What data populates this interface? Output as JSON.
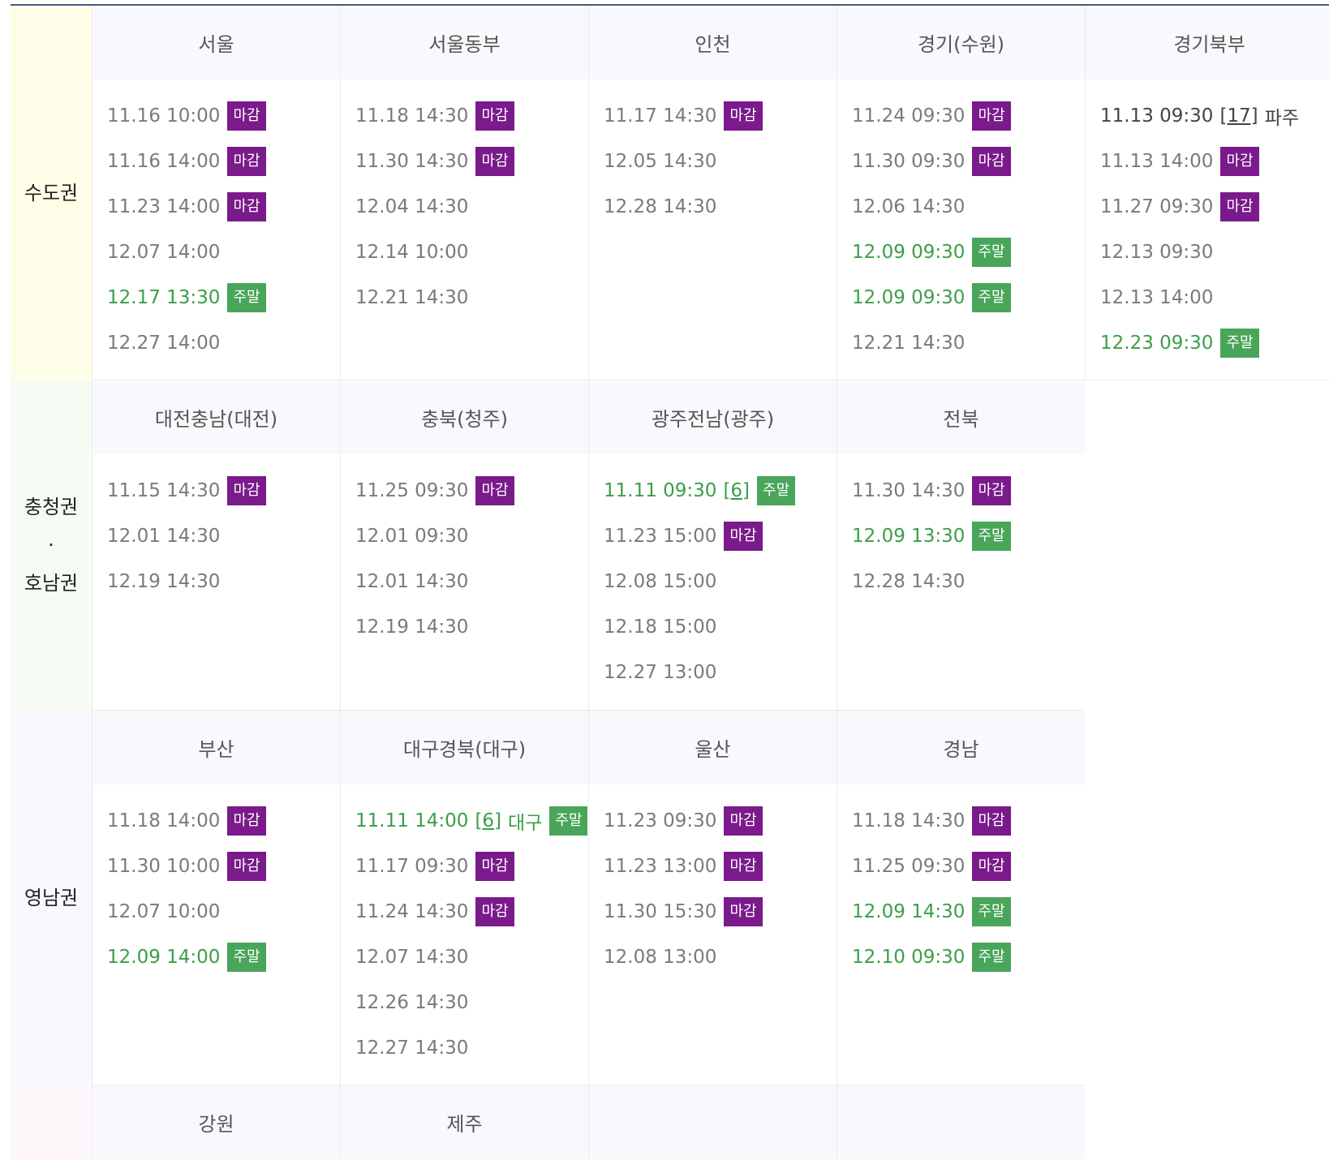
{
  "colors": {
    "closed_badge": "#7a1a8b",
    "weekend_badge": "#48a55a",
    "weekend_text": "#3b9e47",
    "header_bg": "#f8f9fc",
    "region_capital_bg": "#fefee8",
    "region_chungho_bg": "#f6fcf3",
    "region_yeongnam_bg": "#f8f8fd",
    "region_other_bg": "#fdf7fc"
  },
  "regions": [
    {
      "label": "수도권",
      "offices": [
        {
          "name": "서울",
          "sessions": [
            {
              "datetime": "11.16 10:00",
              "badge": "마감"
            },
            {
              "datetime": "11.16 14:00",
              "badge": "마감"
            },
            {
              "datetime": "11.23 14:00",
              "badge": "마감"
            },
            {
              "datetime": "12.07 14:00"
            },
            {
              "datetime": "12.17 13:30",
              "badge": "주말",
              "weekend": true
            },
            {
              "datetime": "12.27 14:00"
            }
          ]
        },
        {
          "name": "서울동부",
          "sessions": [
            {
              "datetime": "11.18 14:30",
              "badge": "마감"
            },
            {
              "datetime": "11.30 14:30",
              "badge": "마감"
            },
            {
              "datetime": "12.04 14:30"
            },
            {
              "datetime": "12.14 10:00"
            },
            {
              "datetime": "12.21 14:30"
            }
          ]
        },
        {
          "name": "인천",
          "sessions": [
            {
              "datetime": "11.17 14:30",
              "badge": "마감"
            },
            {
              "datetime": "12.05 14:30"
            },
            {
              "datetime": "12.28 14:30"
            }
          ]
        },
        {
          "name": "경기(수원)",
          "sessions": [
            {
              "datetime": "11.24 09:30",
              "badge": "마감"
            },
            {
              "datetime": "11.30 09:30",
              "badge": "마감"
            },
            {
              "datetime": "12.06 14:30"
            },
            {
              "datetime": "12.09 09:30",
              "badge": "주말",
              "weekend": true
            },
            {
              "datetime": "12.09 09:30",
              "badge": "주말",
              "weekend": true
            },
            {
              "datetime": "12.21 14:30"
            }
          ]
        },
        {
          "name": "경기북부",
          "sessions": [
            {
              "datetime": "11.13 09:30",
              "number": "[17]",
              "location": "파주",
              "dark": true
            },
            {
              "datetime": "11.13 14:00",
              "badge": "마감"
            },
            {
              "datetime": "11.27 09:30",
              "badge": "마감"
            },
            {
              "datetime": "12.13 09:30"
            },
            {
              "datetime": "12.13 14:00"
            },
            {
              "datetime": "12.23 09:30",
              "badge": "주말",
              "weekend": true
            }
          ]
        }
      ]
    },
    {
      "label": "충청권\n·\n호남권",
      "offices": [
        {
          "name": "대전충남(대전)",
          "sessions": [
            {
              "datetime": "11.15 14:30",
              "badge": "마감"
            },
            {
              "datetime": "12.01 14:30"
            },
            {
              "datetime": "12.19 14:30"
            }
          ]
        },
        {
          "name": "충북(청주)",
          "sessions": [
            {
              "datetime": "11.25 09:30",
              "badge": "마감"
            },
            {
              "datetime": "12.01 09:30"
            },
            {
              "datetime": "12.01 14:30"
            },
            {
              "datetime": "12.19 14:30"
            }
          ]
        },
        {
          "name": "광주전남(광주)",
          "sessions": [
            {
              "datetime": "11.11 09:30",
              "number": "[6]",
              "badge": "주말",
              "weekend": true
            },
            {
              "datetime": "11.23 15:00",
              "badge": "마감"
            },
            {
              "datetime": "12.08 15:00"
            },
            {
              "datetime": "12.18 15:00"
            },
            {
              "datetime": "12.27 13:00"
            }
          ]
        },
        {
          "name": "전북",
          "sessions": [
            {
              "datetime": "11.30 14:30",
              "badge": "마감"
            },
            {
              "datetime": "12.09 13:30",
              "badge": "주말",
              "weekend": true
            },
            {
              "datetime": "12.28 14:30"
            }
          ]
        }
      ]
    },
    {
      "label": "영남권",
      "offices": [
        {
          "name": "부산",
          "sessions": [
            {
              "datetime": "11.18 14:00",
              "badge": "마감"
            },
            {
              "datetime": "11.30 10:00",
              "badge": "마감"
            },
            {
              "datetime": "12.07 10:00"
            },
            {
              "datetime": "12.09 14:00",
              "badge": "주말",
              "weekend": true
            }
          ]
        },
        {
          "name": "대구경북(대구)",
          "sessions": [
            {
              "datetime": "11.11 14:00",
              "number": "[6]",
              "location": "대구",
              "badge": "주말",
              "weekend": true
            },
            {
              "datetime": "11.17 09:30",
              "badge": "마감"
            },
            {
              "datetime": "11.24 14:30",
              "badge": "마감"
            },
            {
              "datetime": "12.07 14:30"
            },
            {
              "datetime": "12.26 14:30"
            },
            {
              "datetime": "12.27 14:30"
            }
          ]
        },
        {
          "name": "울산",
          "sessions": [
            {
              "datetime": "11.23 09:30",
              "badge": "마감"
            },
            {
              "datetime": "11.23 13:00",
              "badge": "마감"
            },
            {
              "datetime": "11.30 15:30",
              "badge": "마감"
            },
            {
              "datetime": "12.08 13:00"
            }
          ]
        },
        {
          "name": "경남",
          "sessions": [
            {
              "datetime": "11.18 14:30",
              "badge": "마감"
            },
            {
              "datetime": "11.25 09:30",
              "badge": "마감"
            },
            {
              "datetime": "12.09 14:30",
              "badge": "주말",
              "weekend": true
            },
            {
              "datetime": "12.10 09:30",
              "badge": "주말",
              "weekend": true
            }
          ]
        }
      ]
    },
    {
      "label": "",
      "offices": [
        {
          "name": "강원",
          "sessions": []
        },
        {
          "name": "제주",
          "sessions": []
        },
        {
          "name": "",
          "sessions": []
        },
        {
          "name": "",
          "sessions": []
        }
      ]
    }
  ]
}
